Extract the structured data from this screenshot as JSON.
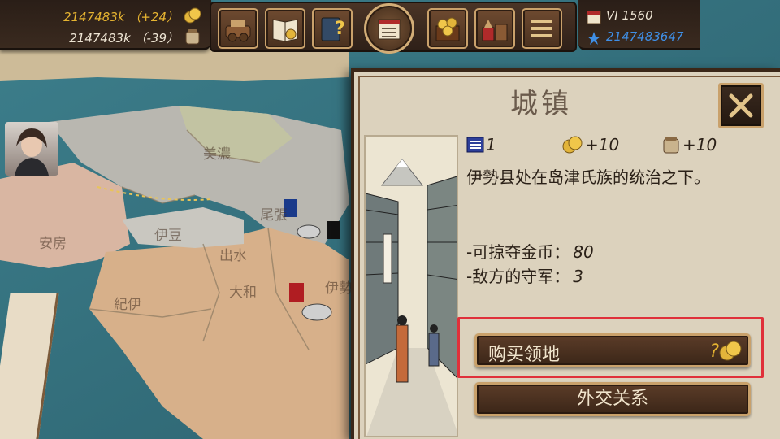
{
  "resources": {
    "gold": "2147483k （+24）",
    "food": "2147483k （-39）"
  },
  "date": {
    "text": "VI 1560",
    "prestige": "2147483647"
  },
  "menu_icons": [
    "army-icon",
    "codex-icon",
    "quests-icon",
    "calendar-icon",
    "treasury-icon",
    "market-icon",
    "menu-icon"
  ],
  "map": {
    "regions": [
      "安房",
      "伊豆",
      "出水",
      "大和",
      "紀伊",
      "伊勢",
      "尾張",
      "美濃"
    ]
  },
  "dialog": {
    "title": "城镇",
    "stats": {
      "level": "1",
      "gold": "+10",
      "food": "+10"
    },
    "description": "伊勢县处在岛津氏族的统治之下。",
    "loot_label": "-可掠夺金币：",
    "loot_value": "80",
    "garrison_label": "-敌方的守军：",
    "garrison_value": "3",
    "buy_button": "购买领地",
    "buy_cost": "?",
    "diplomacy_button": "外交关系"
  },
  "colors": {
    "gold_text": "#e6b431",
    "prestige_text": "#3f8fe6",
    "highlight": "#e0303a",
    "parchment": "#dcd2bd"
  }
}
